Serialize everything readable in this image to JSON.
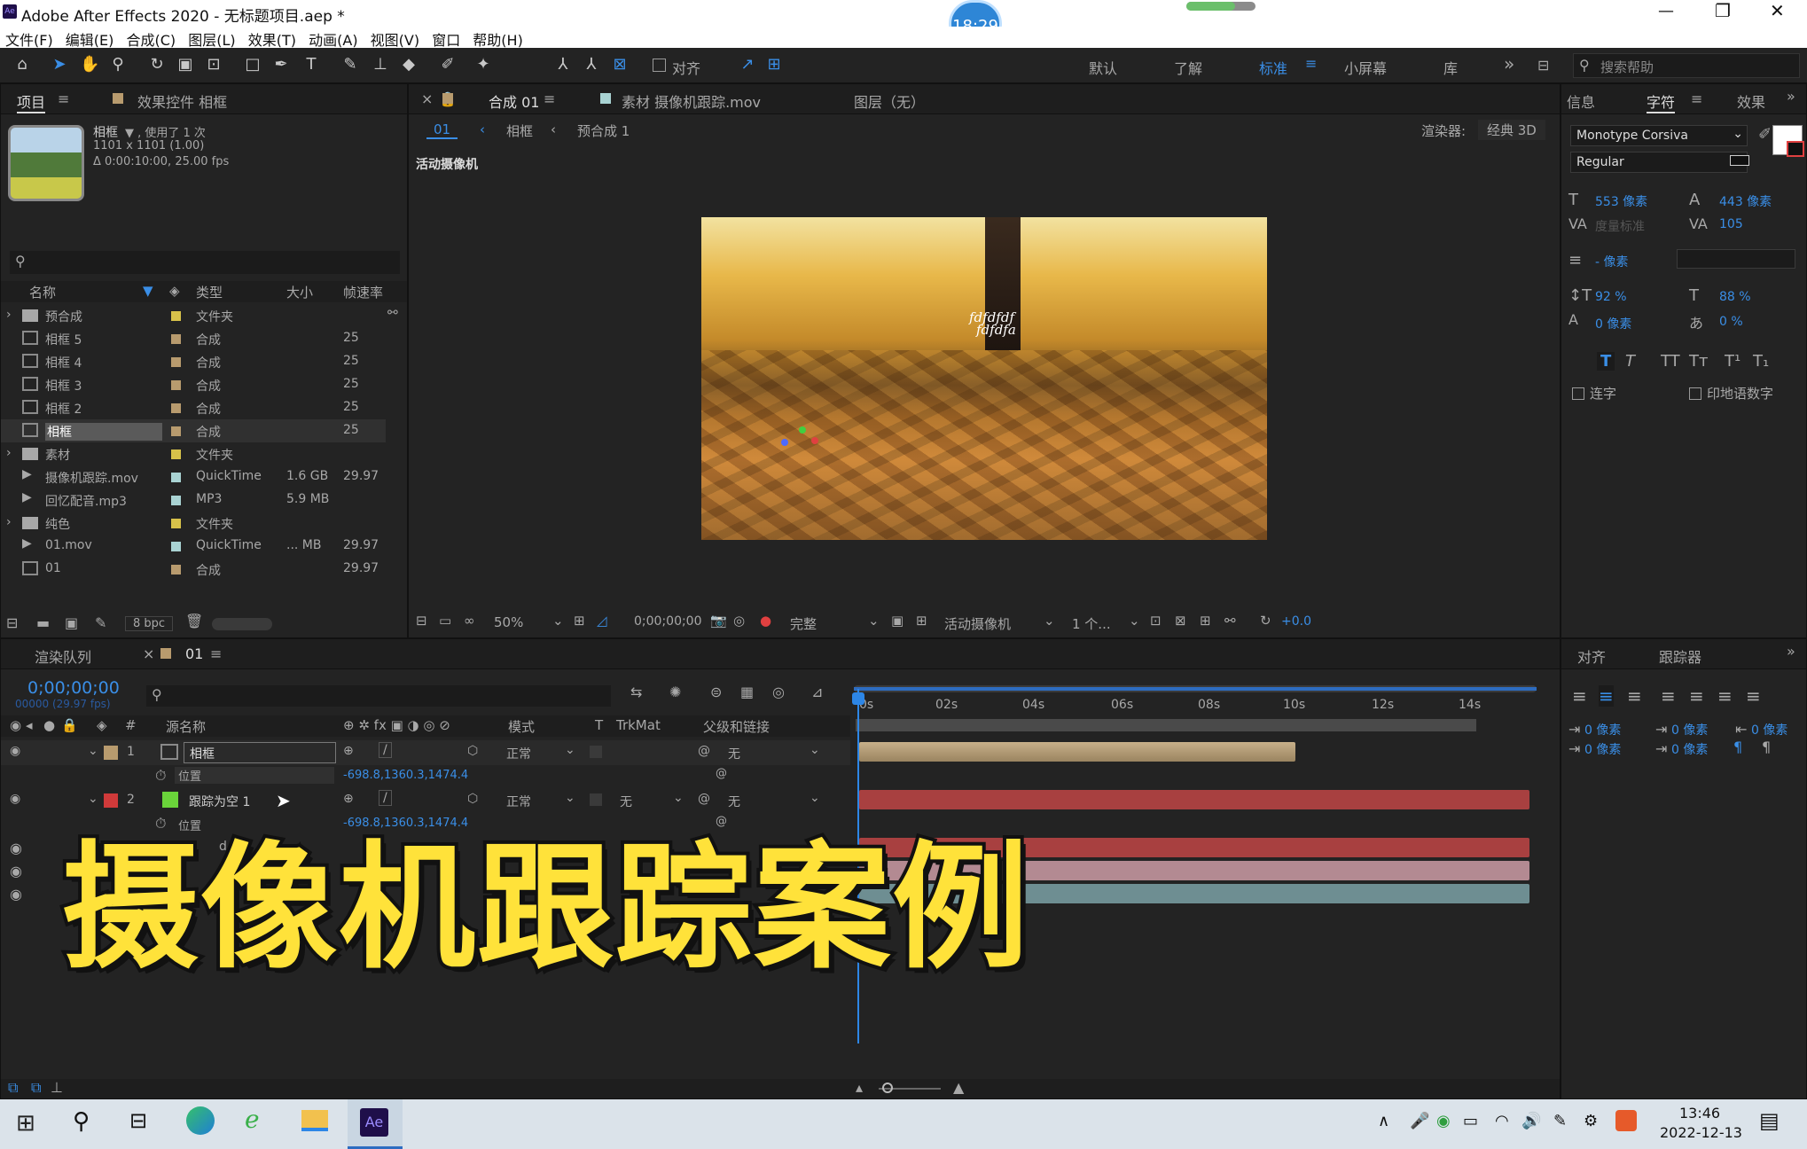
{
  "window": {
    "title": "Adobe After Effects 2020 - 无标题项目.aep *",
    "clock": "18:29"
  },
  "menu": [
    "文件(F)",
    "编辑(E)",
    "合成(C)",
    "图层(L)",
    "效果(T)",
    "动画(A)",
    "视图(V)",
    "窗口",
    "帮助(H)"
  ],
  "toolbar": {
    "align_label": "对齐",
    "workspaces": [
      "默认",
      "了解",
      "标准",
      "小屏幕",
      "库"
    ],
    "active_workspace": "标准",
    "search_placeholder": "搜索帮助"
  },
  "project": {
    "tab": "项目",
    "effects_tab": "效果控件 相框",
    "item_name": "相框",
    "used": "▼ , 使用了 1 次",
    "dims": "1101 x 1101 (1.00)",
    "duration": "Δ 0:00:10:00, 25.00 fps",
    "columns": [
      "名称",
      "类型",
      "大小",
      "帧速率"
    ],
    "items": [
      {
        "name": "预合成",
        "type": "文件夹",
        "size": "",
        "fps": ""
      },
      {
        "name": "相框 5",
        "type": "合成",
        "size": "",
        "fps": "25"
      },
      {
        "name": "相框 4",
        "type": "合成",
        "size": "",
        "fps": "25"
      },
      {
        "name": "相框 3",
        "type": "合成",
        "size": "",
        "fps": "25"
      },
      {
        "name": "相框 2",
        "type": "合成",
        "size": "",
        "fps": "25"
      },
      {
        "name": "相框",
        "type": "合成",
        "size": "",
        "fps": "25"
      },
      {
        "name": "素材",
        "type": "文件夹",
        "size": "",
        "fps": ""
      },
      {
        "name": "摄像机跟踪.mov",
        "type": "QuickTime",
        "size": "1.6 GB",
        "fps": "29.97"
      },
      {
        "name": "回忆配音.mp3",
        "type": "MP3",
        "size": "5.9 MB",
        "fps": ""
      },
      {
        "name": "纯色",
        "type": "文件夹",
        "size": "",
        "fps": ""
      },
      {
        "name": "01.mov",
        "type": "QuickTime",
        "size": "... MB",
        "fps": "29.97"
      },
      {
        "name": "01",
        "type": "合成",
        "size": "",
        "fps": "29.97"
      }
    ],
    "bpc": "8 bpc"
  },
  "comp": {
    "tab": "合成 01",
    "footage_tab": "素材 摄像机跟踪.mov",
    "layer_tab": "图层（无）",
    "crumbs": [
      "01",
      "相框",
      "预合成 1"
    ],
    "renderer_label": "渲染器:",
    "renderer": "经典 3D",
    "camera_label": "活动摄像机",
    "overlay_text_1": "fdfdfdf",
    "overlay_text_2": "fdfdfa",
    "bottom": {
      "zoom": "50%",
      "timecode": "0;00;00;00",
      "quality": "完整",
      "camera": "活动摄像机",
      "views": "1 个...",
      "exposure": "+0.0"
    }
  },
  "character": {
    "tab_info": "信息",
    "tab_char": "字符",
    "tab_fx": "效果",
    "font": "Monotype Corsiva",
    "style": "Regular",
    "size": "553 像素",
    "leading": "443 像素",
    "kerning": "度量标准",
    "tracking": "105",
    "stroke": "- 像素",
    "vscale": "92 %",
    "hscale": "88 %",
    "baseline": "0 像素",
    "tsume": "0 %",
    "ligature": "连字",
    "hindi": "印地语数字"
  },
  "timeline": {
    "render_tab": "渲染队列",
    "comp_tab": "01",
    "timecode": "0;00;00;00",
    "frames": "00000 (29.97 fps)",
    "cols": [
      "源名称",
      "模式",
      "T",
      "TrkMat",
      "父级和链接"
    ],
    "ruler": [
      "0s",
      "02s",
      "04s",
      "06s",
      "08s",
      "10s",
      "12s",
      "14s"
    ],
    "layers": [
      {
        "num": "1",
        "name": "相框",
        "mode": "正常",
        "trk": "",
        "parent": "无",
        "prop": "位置",
        "value": "-698.8,1360.3,1474.4"
      },
      {
        "num": "2",
        "name": "跟踪为空 1",
        "mode": "正常",
        "trk": "无",
        "parent": "无",
        "prop": "位置",
        "value": "-698.8,1360.3,1474.4"
      }
    ],
    "hidden_layer_frag": "d"
  },
  "align_panel": {
    "tab_align": "对齐",
    "tab_tracker": "跟踪器",
    "v1": "0 像素",
    "v2": "0 像素",
    "v3": "0 像素",
    "v4": "0 像素",
    "v5": "0 像素"
  },
  "overlay_caption": "摄像机跟踪案例",
  "taskbar": {
    "time": "13:46",
    "date": "2022-12-13",
    "ae_label": "Ae"
  }
}
